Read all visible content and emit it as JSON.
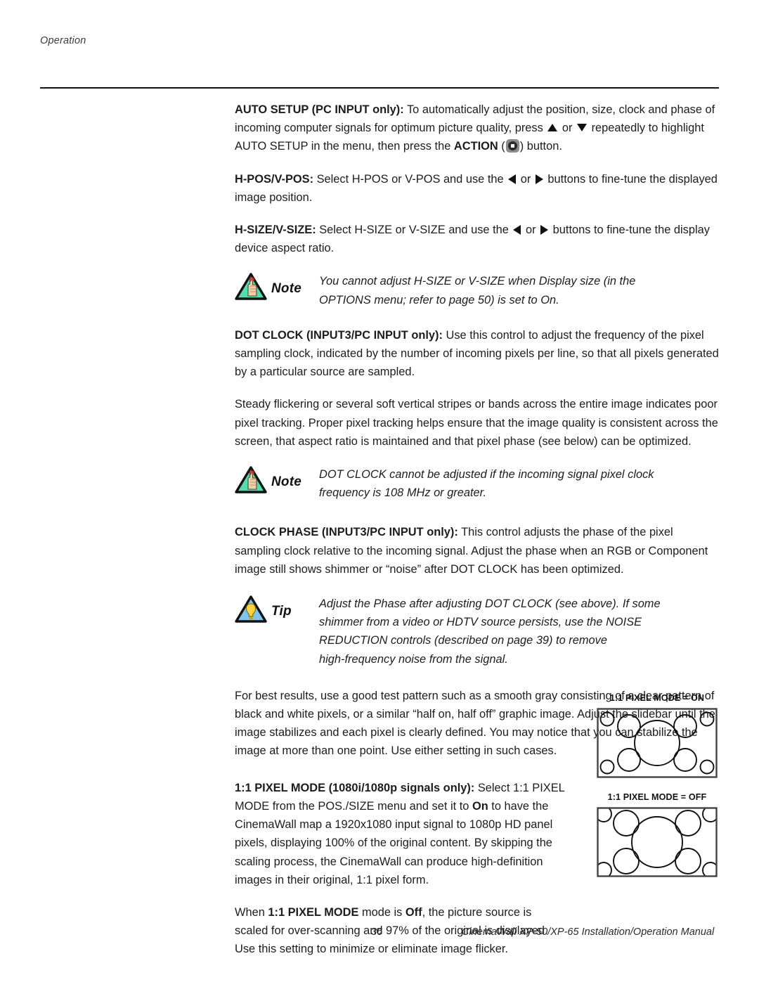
{
  "header": {
    "running_head": "Operation"
  },
  "sections": {
    "auto_setup": {
      "lead": "AUTO SETUP (PC INPUT only):",
      "t1": " To automatically adjust the position, size, clock and phase of incoming computer signals for optimum picture quality, press ",
      "t2": " or ",
      "t3": " repeatedly to highlight AUTO SETUP in the menu, then press the ",
      "bold_action": "ACTION",
      "t4": " (",
      "t5": ") button."
    },
    "h_pos_v_pos": {
      "lead": "H-POS/V-POS:",
      "t1": " Select H-POS or V-POS and use the ",
      "t2": " or ",
      "t3": " buttons to fine-tune the displayed image position."
    },
    "h_size_v_size": {
      "lead": "H-SIZE/V-SIZE:",
      "t1": " Select H-SIZE or V-SIZE and use the ",
      "t2": " or ",
      "t3": " buttons to fine-tune the display device aspect ratio."
    },
    "note_1": {
      "word": "Note",
      "lines": [
        "You cannot adjust H-SIZE or V-SIZE when Display size (in the",
        "OPTIONS menu; refer to page 50) is set to On."
      ]
    },
    "dot_clock": {
      "lead": "DOT CLOCK (INPUT3/PC INPUT only):",
      "text": " Use this control to adjust the frequency of the pixel sampling clock, indicated by the number of incoming pixels per line, so that all pixels generated by a particular source are sampled."
    },
    "steady_flickering": {
      "text": "Steady flickering or several soft vertical stripes or bands across the entire image indicates poor pixel tracking. Proper pixel tracking helps ensure that the image quality is consistent across the screen, that aspect ratio is maintained and that pixel phase (see below) can be optimized."
    },
    "note_2": {
      "word": "Note",
      "lines": [
        "DOT CLOCK cannot be adjusted if the incoming signal pixel clock",
        "frequency is 108 MHz or greater."
      ]
    },
    "clock_phase": {
      "lead": "CLOCK PHASE (INPUT3/PC INPUT only):",
      "text": " This control adjusts the phase of the pixel sampling clock relative to the incoming signal. Adjust the phase when an RGB or Component image still shows shimmer or “noise” after DOT CLOCK has been optimized."
    },
    "tip": {
      "word": "Tip",
      "lines": [
        "Adjust the Phase after adjusting DOT CLOCK (see above). If some",
        "shimmer from a video or HDTV source persists, use the NOISE",
        "REDUCTION controls (described on page 39) to remove",
        "high-frequency noise from the signal."
      ]
    },
    "best_results": {
      "text": "For best results, use a good test pattern such as a smooth gray consisting of a clear pattern of black and white pixels, or a similar “half on, half off” graphic image. Adjust the slidebar until the image stabilizes and each pixel is clearly defined. You may notice that you can stabilize the image at more than one point. Use either setting in such cases."
    },
    "pixel_mode": {
      "lead": "1:1 PIXEL MODE (1080i/1080p signals only):",
      "t1": " Select 1:1 PIXEL MODE from the POS./SIZE menu and set it to ",
      "bold_on": "On",
      "t2": " to have the CinemaWall map a 1920x1080 input signal to 1080p HD panel pixels, displaying 100% of the original content. By skipping the scaling process, the CinemaWall can produce high-definition images in their original, 1:1 pixel form."
    },
    "pixel_mode_off": {
      "t1": "When ",
      "bold_mode": "1:1 PIXEL MODE",
      "t2": " mode is ",
      "bold_off": "Off",
      "t3": ", the picture source is scaled for over-scanning and 97% of the original is displayed. Use this setting to minimize or eliminate image flicker."
    }
  },
  "figures": [
    {
      "label": "1:1 PIXEL MODE = ON"
    },
    {
      "label": "1:1 PIXEL MODE = OFF"
    }
  ],
  "footer": {
    "page_number": "36",
    "manual_title": "CinemaWall XP-50/XP-65 Installation/Operation Manual"
  },
  "colors": {
    "note_triangle_fill": "#4fe0b0",
    "tip_triangle_fill": "#7fc4ee",
    "bulb_fill": "#ffd33d",
    "hand_fill": "#f3cfa8",
    "string_red": "#e02020",
    "ink": "#1a1a1a",
    "action_button_gray": "#8c8c8c"
  }
}
